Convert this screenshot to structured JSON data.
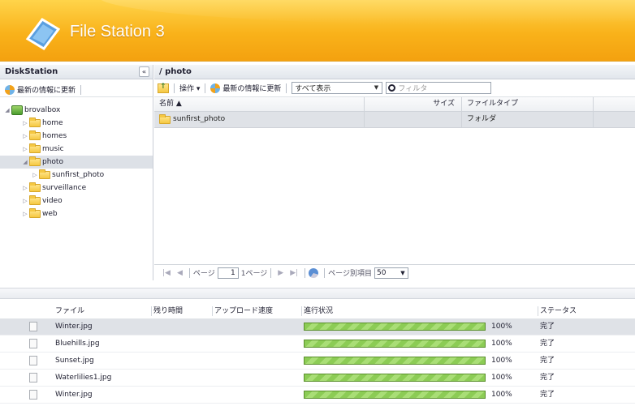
{
  "app": {
    "title": "File Station 3"
  },
  "left": {
    "title": "DiskStation",
    "collapse_label": "«",
    "refresh_label": "最新の情報に更新",
    "tree": [
      {
        "label": "brovalbox",
        "level": 0,
        "expanded": true,
        "icon": "host-icon"
      },
      {
        "label": "home",
        "level": 1
      },
      {
        "label": "homes",
        "level": 1
      },
      {
        "label": "music",
        "level": 1
      },
      {
        "label": "photo",
        "level": 1,
        "expanded": true,
        "selected": true
      },
      {
        "label": "sunfirst_photo",
        "level": 2
      },
      {
        "label": "surveillance",
        "level": 1
      },
      {
        "label": "video",
        "level": 1
      },
      {
        "label": "web",
        "level": 1
      }
    ]
  },
  "right": {
    "path": "/ photo",
    "toolbar": {
      "action_label": "操作 ▾",
      "refresh_label": "最新の情報に更新",
      "view_value": "すべて表示",
      "filter_placeholder": "フィルタ"
    },
    "columns": {
      "name": "名前 ▲",
      "size": "サイズ",
      "type": "ファイルタイプ"
    },
    "rows": [
      {
        "name": "sunfirst_photo",
        "size": "",
        "type": "フォルダ"
      }
    ],
    "pager": {
      "page_label": "ページ",
      "page_value": "1",
      "of_label": "1ページ",
      "per_page_label": "ページ別項目",
      "per_page_value": "50"
    }
  },
  "transfer": {
    "columns": {
      "file": "ファイル",
      "remaining": "残り時間",
      "speed": "アップロード速度",
      "progress": "進行状況",
      "status": "ステータス"
    },
    "rows": [
      {
        "file": "Winter.jpg",
        "progress": 100,
        "progress_text": "100%",
        "status": "完了",
        "selected": true
      },
      {
        "file": "Bluehills.jpg",
        "progress": 100,
        "progress_text": "100%",
        "status": "完了"
      },
      {
        "file": "Sunset.jpg",
        "progress": 100,
        "progress_text": "100%",
        "status": "完了"
      },
      {
        "file": "Waterlilies1.jpg",
        "progress": 100,
        "progress_text": "100%",
        "status": "完了"
      },
      {
        "file": "Winter.jpg",
        "progress": 100,
        "progress_text": "100%",
        "status": "完了"
      }
    ]
  }
}
